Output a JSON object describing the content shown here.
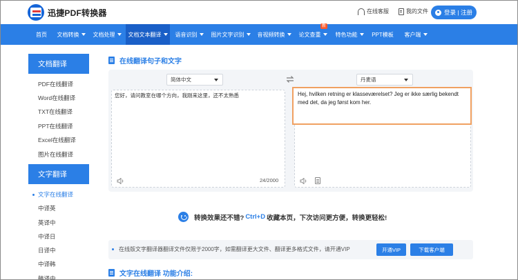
{
  "brand": {
    "name": "迅捷PDF转换器"
  },
  "header": {
    "service_label": "在线客服",
    "files_label": "我的文件",
    "login_label": "登录 | 注册"
  },
  "nav": {
    "items": [
      {
        "label": "首页",
        "has_menu": false
      },
      {
        "label": "文档转换",
        "has_menu": true
      },
      {
        "label": "文档处理",
        "has_menu": true
      },
      {
        "label": "文档文本翻译",
        "has_menu": true,
        "active": true
      },
      {
        "label": "语音识别",
        "has_menu": true
      },
      {
        "label": "图片文字识别",
        "has_menu": true
      },
      {
        "label": "音视频转换",
        "has_menu": true
      },
      {
        "label": "论文查重",
        "has_menu": true,
        "badge": "新"
      },
      {
        "label": "特色功能",
        "has_menu": true
      },
      {
        "label": "PPT模板",
        "has_menu": false
      },
      {
        "label": "客户端",
        "has_menu": true
      }
    ]
  },
  "sidebar": {
    "doc_group": {
      "title": "文档翻译",
      "items": [
        "PDF在线翻译",
        "Word在线翻译",
        "TXT在线翻译",
        "PPT在线翻译",
        "Excel在线翻译",
        "图片在线翻译"
      ]
    },
    "text_group": {
      "title": "文字翻译",
      "items": [
        "文字在线翻译",
        "中译英",
        "英译中",
        "中译日",
        "日译中",
        "中译韩",
        "韩译中"
      ]
    }
  },
  "main": {
    "section_title": "在线翻译句子和文字",
    "source_lang": "简体中文",
    "target_lang": "丹麦语",
    "source_text": "您好，请问教室在哪个方向，我刚来这里，还不太熟悉",
    "output_text": "Hej, hvilken retning er klasseværelset? Jeg er ikke særlig bekendt med det, da jeg først kom her.",
    "char_count": "24/2000",
    "promo_before": "转换效果还不错?",
    "promo_shortcut": "Ctrl+D",
    "promo_after": "收藏本页，下次访问更方便，转换更轻松!",
    "notice_text": "在线版文字翻译器翻译文件仅限于2000字，如需翻译更大文件、翻译更多格式文件，请开通VIP",
    "vip_button": "开通VIP",
    "client_button": "下载客户端",
    "intro_title": "文字在线翻译 功能介绍:"
  },
  "colors": {
    "primary": "#2b7fe6",
    "nav_active": "#1a5fc7",
    "highlight_border": "#f0a060",
    "badge": "#ff5a2c"
  }
}
